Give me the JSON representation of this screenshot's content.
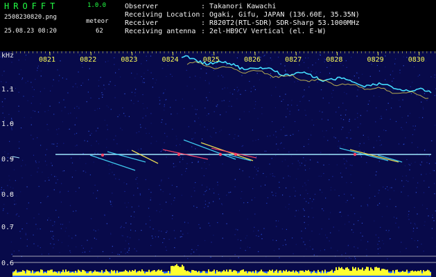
{
  "header": {
    "app_title": "HROFFT",
    "app_version": "1.0.0",
    "file_name": "2508230820.png",
    "timestamp": "25.08.23 08:20",
    "meteor_label": "meteor",
    "meteor_count": "62",
    "info": [
      {
        "key": "Observer",
        "value": ": Takanori Kawachi"
      },
      {
        "key": "Receiving Location",
        "value": ": Ogaki, Gifu, JAPAN (136.60E, 35.35N)"
      },
      {
        "key": "Receiver",
        "value": ": R820T2(RTL-SDR) SDR-Sharp 53.1000MHz"
      },
      {
        "key": "Receiving antenna",
        "value": ": 2el-HB9CV Vertical (el. E-W)"
      }
    ]
  },
  "waterfall": {
    "unit_label": "kHz",
    "time_labels": [
      "0821",
      "0822",
      "0823",
      "0824",
      "0825",
      "0826",
      "0827",
      "0828",
      "0829",
      "0830"
    ],
    "freq_labels": [
      "1.1",
      "1.0",
      "0.9",
      "0.8",
      "0.7",
      "0.6"
    ],
    "colors": {
      "background": "#080a4a",
      "signal_line": "#9fe8ff",
      "meteor_hot": "#ff4466",
      "meteor_warm": "#ffee55",
      "meteor_cool": "#44ddff",
      "spectrum": "#ffff30",
      "spectrum_base": "#2060ff"
    }
  }
}
